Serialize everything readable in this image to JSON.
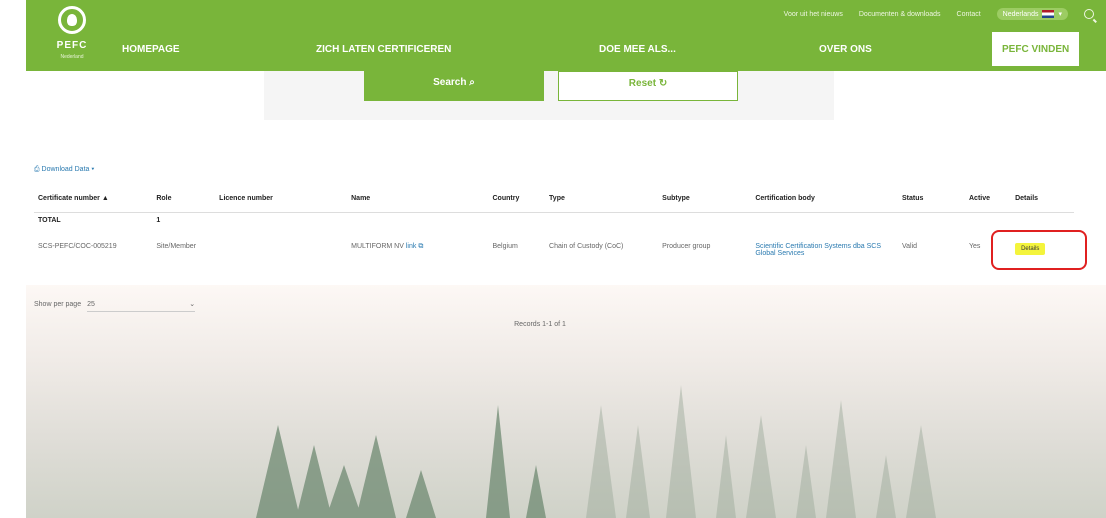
{
  "header": {
    "logo_text": "PEFC",
    "logo_sub": "Nederland",
    "utility_links": [
      "Voor uit het nieuws",
      "Documenten & downloads",
      "Contact"
    ],
    "language": "Nederlands",
    "nav": [
      "HOMEPAGE",
      "ZICH LATEN CERTIFICEREN",
      "DOE MEE ALS...",
      "OVER ONS",
      "PEFC VINDEN"
    ]
  },
  "search": {
    "search_label": "Search",
    "search_icon": "search-icon",
    "reset_label": "Reset",
    "reset_icon": "refresh-icon"
  },
  "download_label": "Download Data",
  "table": {
    "headers": [
      "Certificate number",
      "Role",
      "Licence number",
      "Name",
      "Country",
      "Type",
      "Subtype",
      "Certification body",
      "Status",
      "Active",
      "Details"
    ],
    "total_label": "TOTAL",
    "total_count": "1",
    "rows": [
      {
        "certificate_number": "SCS-PEFC/COC-005219",
        "role": "Site/Member",
        "licence_number": "",
        "name": "MULTIFORM NV",
        "name_link": "link",
        "country": "Belgium",
        "type": "Chain of Custody (CoC)",
        "subtype": "Producer group",
        "certification_body": "Scientific Certification Systems dba SCS Global Services",
        "status": "Valid",
        "active": "Yes",
        "details": "Details"
      }
    ]
  },
  "pagination": {
    "show_per_page_label": "Show per page",
    "per_page_value": "25",
    "records_label": "Records 1-1 of 1"
  },
  "colors": {
    "brand_green": "#79b53a",
    "link_blue": "#2a7ab0",
    "highlight_red": "#e02020",
    "details_yellow": "#f4f43c"
  }
}
